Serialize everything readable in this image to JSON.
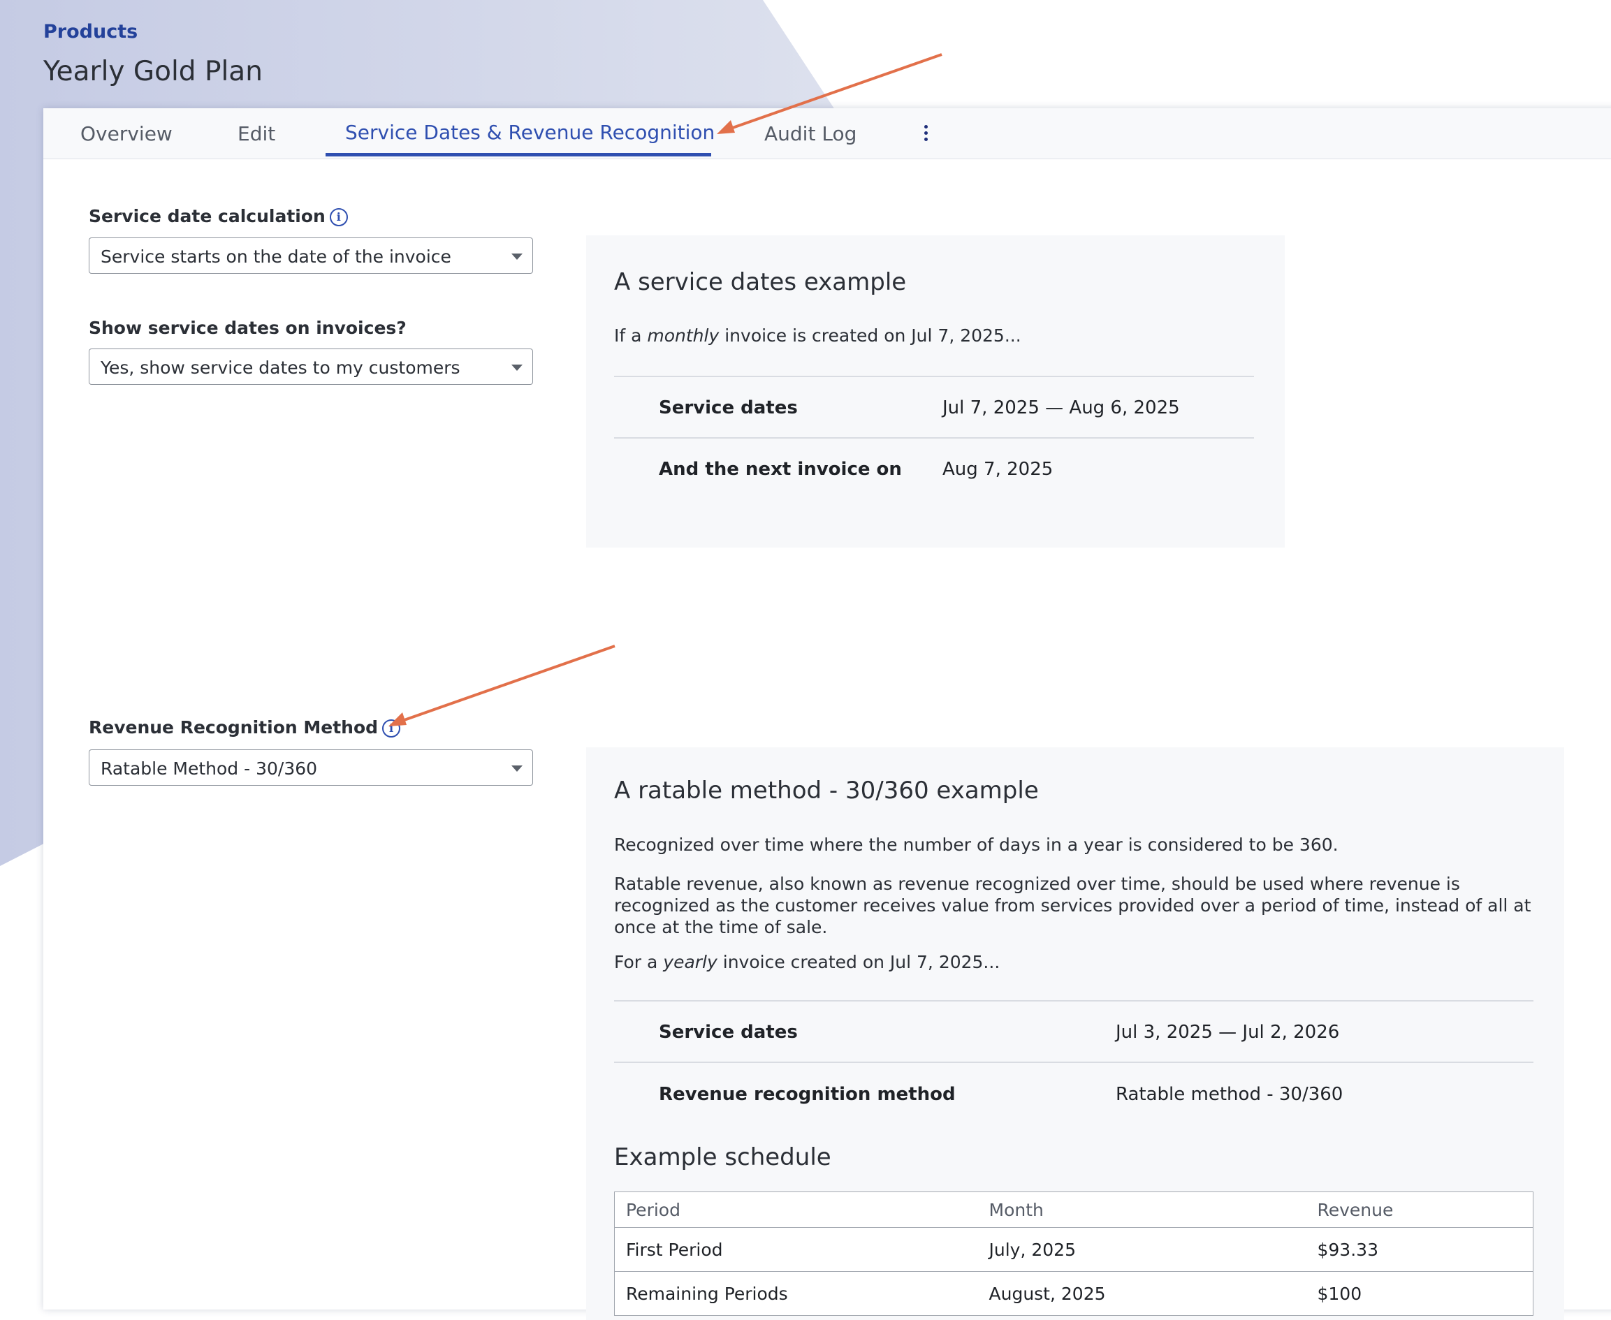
{
  "breadcrumb": "Products",
  "page_title": "Yearly Gold Plan",
  "tabs": [
    {
      "label": "Overview"
    },
    {
      "label": "Edit"
    },
    {
      "label": "Service Dates & Revenue Recognition"
    },
    {
      "label": "Audit Log"
    }
  ],
  "active_tab": "Service Dates & Revenue Recognition",
  "service_date": {
    "label": "Service date calculation",
    "value": "Service starts on the date of the invoice"
  },
  "show_dates": {
    "label": "Show service dates on invoices?",
    "value": "Yes, show service dates to my customers"
  },
  "revenue_method": {
    "label": "Revenue Recognition Method",
    "value": "Ratable Method - 30/360"
  },
  "service_example": {
    "title": "A service dates example",
    "intro_prefix": "If a ",
    "intro_emphasis": "monthly",
    "intro_suffix": " invoice is created on Jul 7, 2025...",
    "rows": [
      {
        "key": "Service dates",
        "value": "Jul 7, 2025 — Aug 6, 2025"
      },
      {
        "key": "And the next invoice on",
        "value": "Aug 7, 2025"
      }
    ]
  },
  "ratable_example": {
    "title": "A ratable method - 30/360 example",
    "para1": "Recognized over time where the number of days in a year is considered to be 360.",
    "para2": "Ratable revenue, also known as revenue recognized over time, should be used where revenue is recognized as the customer receives value from services provided over a period of time, instead of all at once at the time of sale.",
    "intro_prefix": "For a ",
    "intro_emphasis": "yearly",
    "intro_suffix": " invoice created on Jul 7, 2025...",
    "rows": [
      {
        "key": "Service dates",
        "value": "Jul 3, 2025 — Jul 2, 2026"
      },
      {
        "key": "Revenue recognition method",
        "value": "Ratable method - 30/360"
      }
    ],
    "schedule_title": "Example schedule",
    "schedule_headers": [
      "Period",
      "Month",
      "Revenue"
    ],
    "schedule_rows": [
      [
        "First Period",
        "July, 2025",
        "$93.33"
      ],
      [
        "Remaining Periods",
        "August, 2025",
        "$100"
      ]
    ]
  },
  "colors": {
    "accent": "#2f4fb0",
    "breadcrumb": "#23419a",
    "annotation_arrow": "#e2704a",
    "background_shape": "#d5d9ea"
  }
}
